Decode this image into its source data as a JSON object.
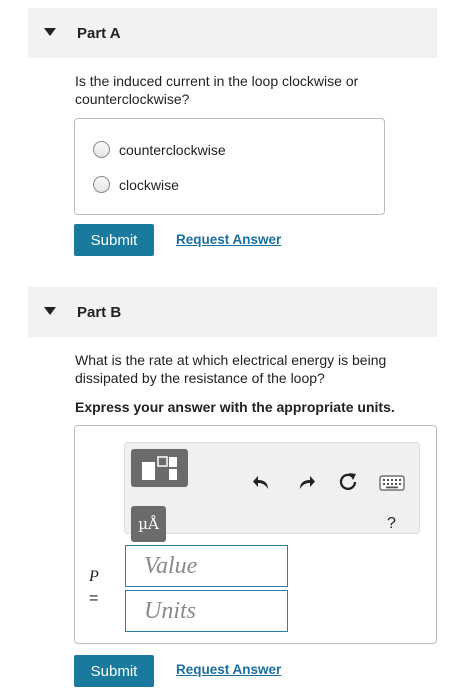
{
  "partA": {
    "title": "Part A",
    "question": "Is the induced current in the loop clockwise or counterclockwise?",
    "choices": [
      {
        "label": "counterclockwise"
      },
      {
        "label": "clockwise"
      }
    ],
    "submit_label": "Submit",
    "request_label": "Request Answer"
  },
  "partB": {
    "title": "Part B",
    "question": "What is the rate at which electrical energy is being dissipated by the resistance of the loop?",
    "instruction": "Express your answer with the appropriate units.",
    "variable": "P",
    "equals": "=",
    "units_button": "µÅ",
    "help_label": "?",
    "value_placeholder": "Value",
    "units_placeholder": "Units",
    "submit_label": "Submit",
    "request_label": "Request Answer"
  },
  "colors": {
    "accent": "#1a7a9e",
    "link": "#1a6fa0",
    "header_bg": "#f2f2f2"
  }
}
